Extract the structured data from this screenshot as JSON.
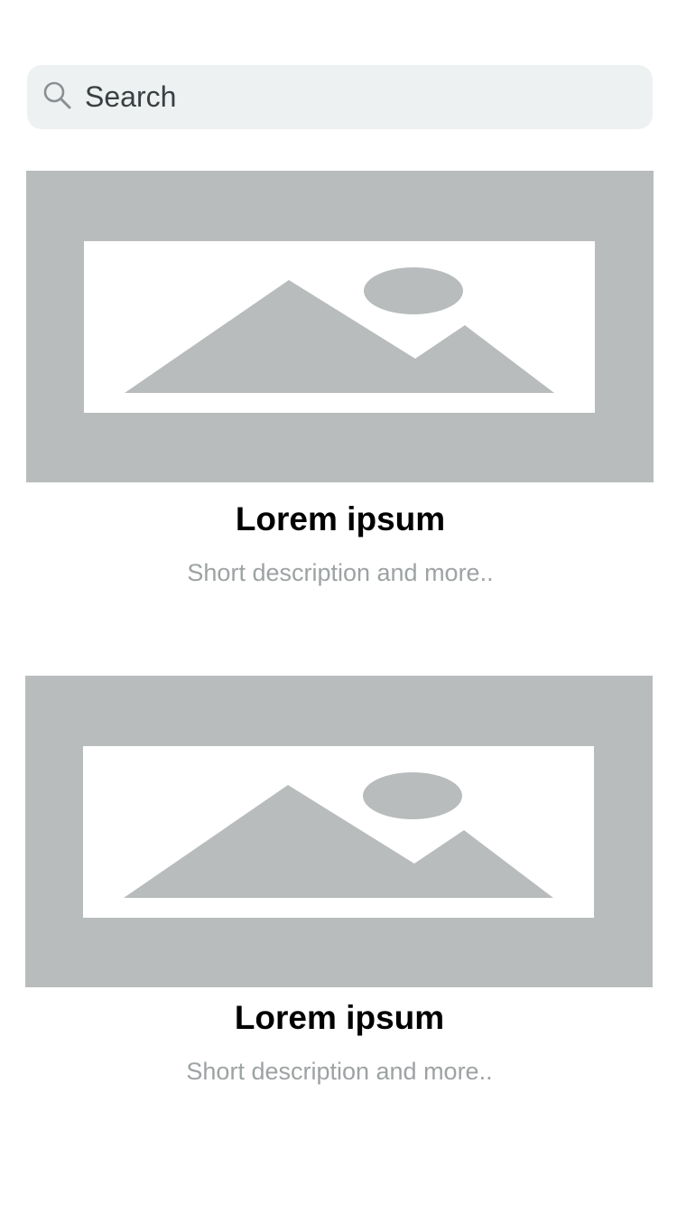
{
  "search": {
    "placeholder": "Search",
    "icon": "search-icon"
  },
  "cards": [
    {
      "title": "Lorem ipsum",
      "description": "Short description and more..",
      "image": "image-placeholder-icon"
    },
    {
      "title": "Lorem ipsum",
      "description": "Short description and more..",
      "image": "image-placeholder-icon"
    }
  ],
  "colors": {
    "placeholder_bg": "#b9bcbd",
    "search_bg": "#eef1f2",
    "description": "#9da2a3"
  }
}
